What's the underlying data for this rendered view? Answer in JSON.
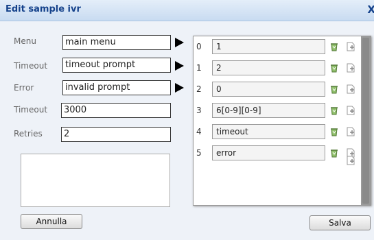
{
  "dialog": {
    "title": "Edit sample ivr",
    "close_label": "X"
  },
  "form": {
    "menu_label": "Menu",
    "menu_value": "main menu",
    "timeout_prompt_label": "Timeout",
    "timeout_prompt_value": "timeout prompt",
    "error_label": "Error",
    "error_value": "invalid prompt",
    "timeout_label": "Timeout",
    "timeout_value": "3000",
    "retries_label": "Retries",
    "retries_value": "2"
  },
  "options": {
    "rows": [
      {
        "index": "0",
        "value": "1"
      },
      {
        "index": "1",
        "value": "2"
      },
      {
        "index": "2",
        "value": "0"
      },
      {
        "index": "3",
        "value": "6[0-9][0-9]"
      },
      {
        "index": "4",
        "value": "timeout"
      },
      {
        "index": "5",
        "value": "error"
      }
    ]
  },
  "buttons": {
    "cancel_label": "Annulla",
    "save_label": "Salva"
  },
  "icons": {
    "delete": "trash-icon",
    "add": "add-page-icon"
  }
}
